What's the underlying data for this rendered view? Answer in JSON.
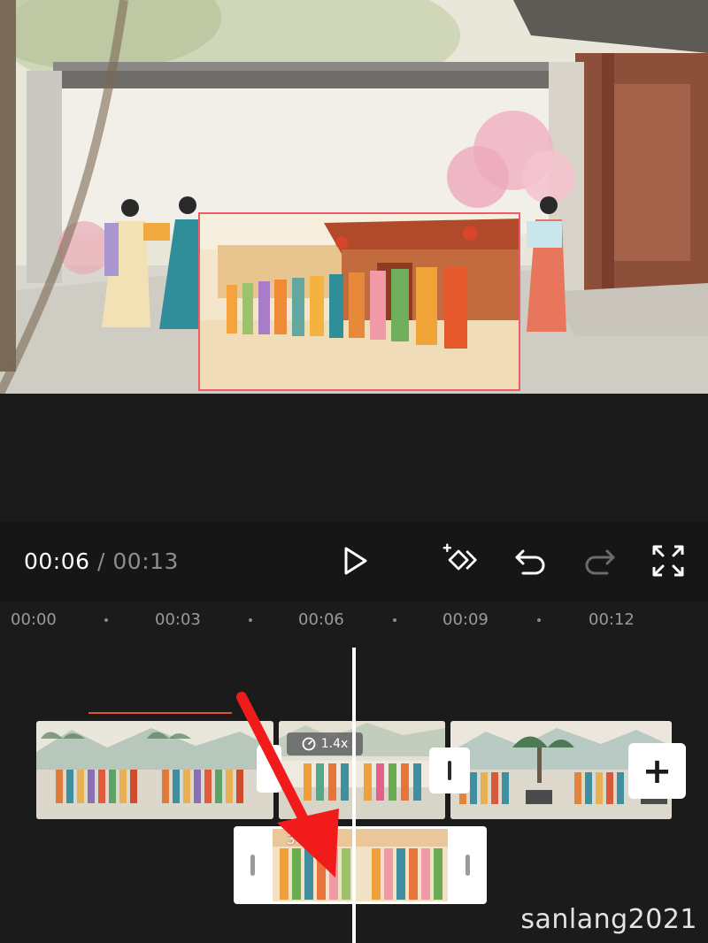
{
  "player": {
    "current_time": "00:06",
    "separator": "/",
    "total_time": "00:13"
  },
  "toolbar": {
    "play_icon": "play-icon",
    "keyframe_icon": "add-keyframe-icon",
    "undo_icon": "undo-icon",
    "redo_icon": "redo-icon",
    "fullscreen_icon": "fullscreen-icon"
  },
  "ruler": {
    "labels": [
      "00:00",
      "00:03",
      "00:06",
      "00:09",
      "00:12"
    ]
  },
  "main_track": {
    "transition_speed": "1.4x",
    "add_label": "+"
  },
  "overlay_track": {
    "duration": "3.6"
  },
  "colors": {
    "accent_red": "#ef5b6b",
    "keyframe_line": "#e0533a",
    "background": "#191919"
  },
  "watermark": "sanlang2021"
}
